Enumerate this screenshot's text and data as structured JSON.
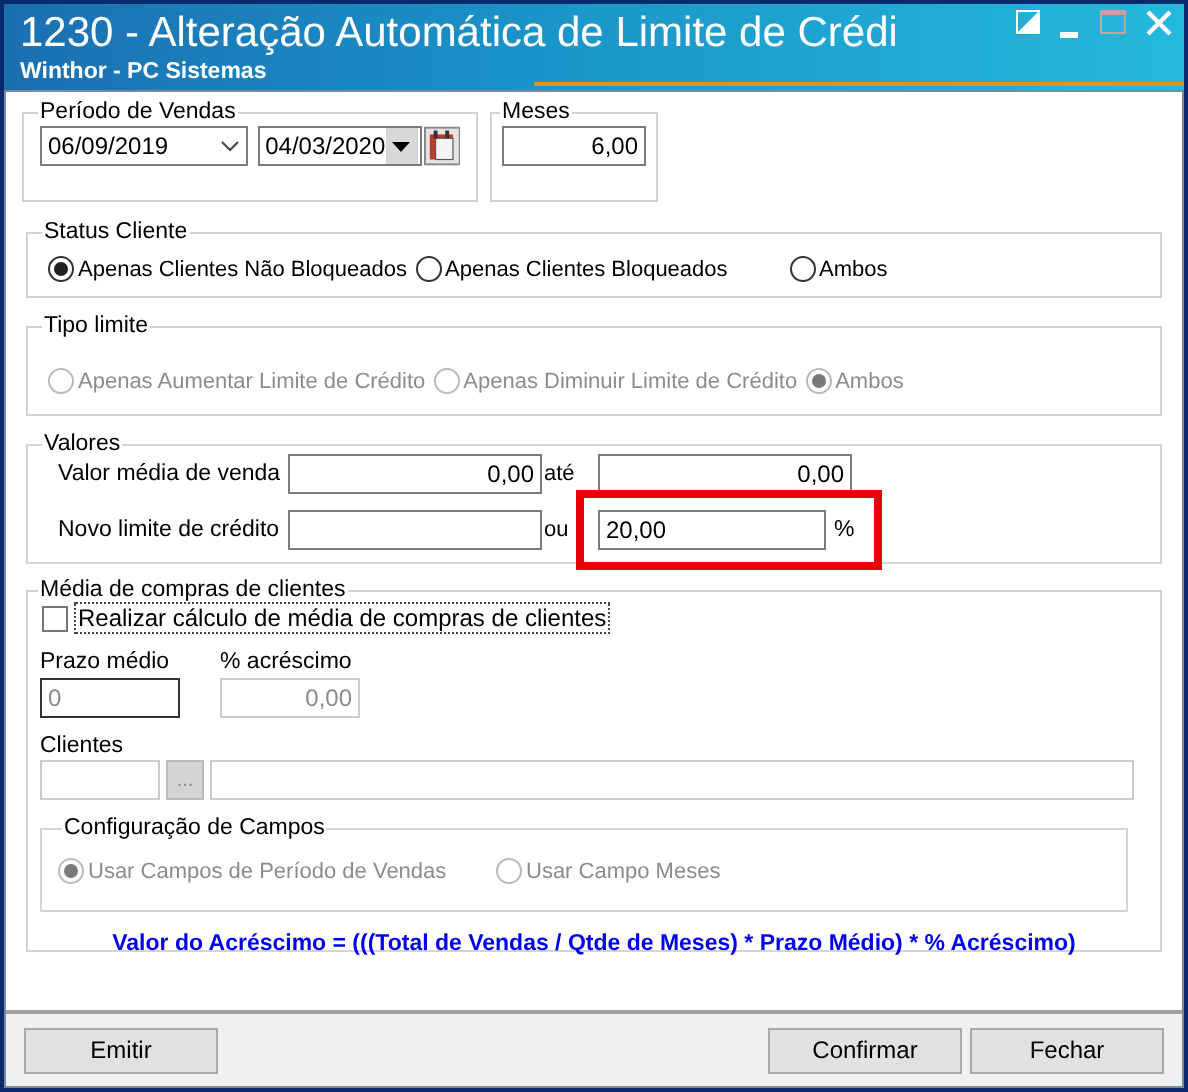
{
  "window": {
    "title": "1230 - Alteração Automática de Limite de Crédi",
    "subtitle": "Winthor - PC Sistemas"
  },
  "periodo": {
    "label": "Período de Vendas",
    "start": "06/09/2019",
    "end": "04/03/2020"
  },
  "meses": {
    "label": "Meses",
    "value": "6,00"
  },
  "status_cliente": {
    "label": "Status Cliente",
    "options": [
      {
        "label": "Apenas Clientes Não Bloqueados",
        "selected": true,
        "disabled": false
      },
      {
        "label": "Apenas Clientes Bloqueados",
        "selected": false,
        "disabled": false
      },
      {
        "label": "Ambos",
        "selected": false,
        "disabled": false
      }
    ]
  },
  "tipo_limite": {
    "label": "Tipo limite",
    "options": [
      {
        "label": "Apenas Aumentar Limite de Crédito",
        "selected": false,
        "disabled": true
      },
      {
        "label": "Apenas Diminuir Limite de Crédito",
        "selected": false,
        "disabled": true
      },
      {
        "label": "Ambos",
        "selected": true,
        "disabled": true
      }
    ]
  },
  "valores": {
    "label": "Valores",
    "rows": [
      {
        "label": "Valor média de venda",
        "from": "0,00",
        "connector": "até",
        "to": "0,00",
        "highlighted": false
      },
      {
        "label": "Novo limite de crédito",
        "connector": "ou",
        "to": "20,00",
        "suffix": "%",
        "highlighted": true
      }
    ]
  },
  "media_compras": {
    "label": "Média de compras de clientes",
    "checkbox": {
      "label": "Realizar cálculo de média de compras de clientes",
      "checked": false
    },
    "prazo": {
      "label": "Prazo médio",
      "value": "0"
    },
    "acrescimo": {
      "label": "% acréscimo",
      "value": "0,00",
      "disabled": true
    },
    "clientes": {
      "label": "Clientes",
      "button": "..."
    },
    "config": {
      "label": "Configuração de Campos",
      "options": [
        {
          "label": "Usar Campos de Período de Vendas",
          "selected": true,
          "disabled": true
        },
        {
          "label": "Usar Campo Meses",
          "selected": false,
          "disabled": true
        }
      ]
    },
    "formula": "Valor do Acréscimo = (((Total de Vendas / Qtde de Meses) * Prazo Médio) * % Acréscimo)"
  },
  "buttons": [
    {
      "label": "Emitir"
    },
    {
      "label": "Confirmar"
    },
    {
      "label": "Fechar"
    }
  ]
}
